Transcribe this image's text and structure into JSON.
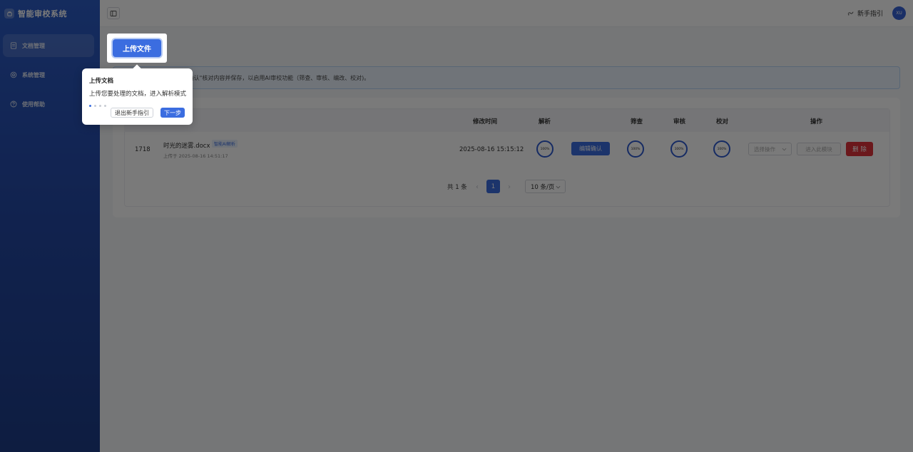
{
  "app": {
    "title": "智能审校系统"
  },
  "sidebar": {
    "items": [
      {
        "label": "文档管理",
        "icon": "document-icon",
        "active": true
      },
      {
        "label": "系统管理",
        "icon": "gear-icon",
        "active": false
      },
      {
        "label": "使用帮助",
        "icon": "help-icon",
        "active": false
      }
    ]
  },
  "header": {
    "guide_label": "新手指引",
    "avatar_initials": "XU"
  },
  "toolbar": {
    "upload_label": "上传文件"
  },
  "info_bar": {
    "text": "析完成后，请点击\"编辑确认\"核对内容并保存，以启用AI审校功能（筛查、审核、编改、校对)。"
  },
  "table": {
    "columns": [
      "修改时间",
      "解析",
      "筛查",
      "审核",
      "校对",
      "操作"
    ],
    "rows": [
      {
        "id": "1718",
        "filename": "时光的迷雾.docx",
        "tag": "智能AI解析",
        "uploaded": "上传于 2025-08-16 14:51:17",
        "modified": "2025-08-16 15:15:12",
        "parse_progress": "100%",
        "edit_confirm_label": "编辑确认",
        "screen_progress": "100%",
        "review_progress": "100%",
        "proof_progress": "100%",
        "select_placeholder": "选择操作",
        "enter_label": "进入此模块",
        "delete_label": "删 除"
      }
    ]
  },
  "pagination": {
    "total_label": "共 1 条",
    "prev": "‹",
    "next": "›",
    "current_page": "1",
    "page_size": "10 条/页"
  },
  "tour": {
    "title": "上传文档",
    "description": "上传您要处理的文档，进入解析模式",
    "step": 1,
    "total_steps": 4,
    "exit_label": "退出新手指引",
    "next_label": "下一步"
  },
  "colors": {
    "primary": "#3b6de0",
    "danger": "#e0323b",
    "sidebar": "#2549a6"
  }
}
